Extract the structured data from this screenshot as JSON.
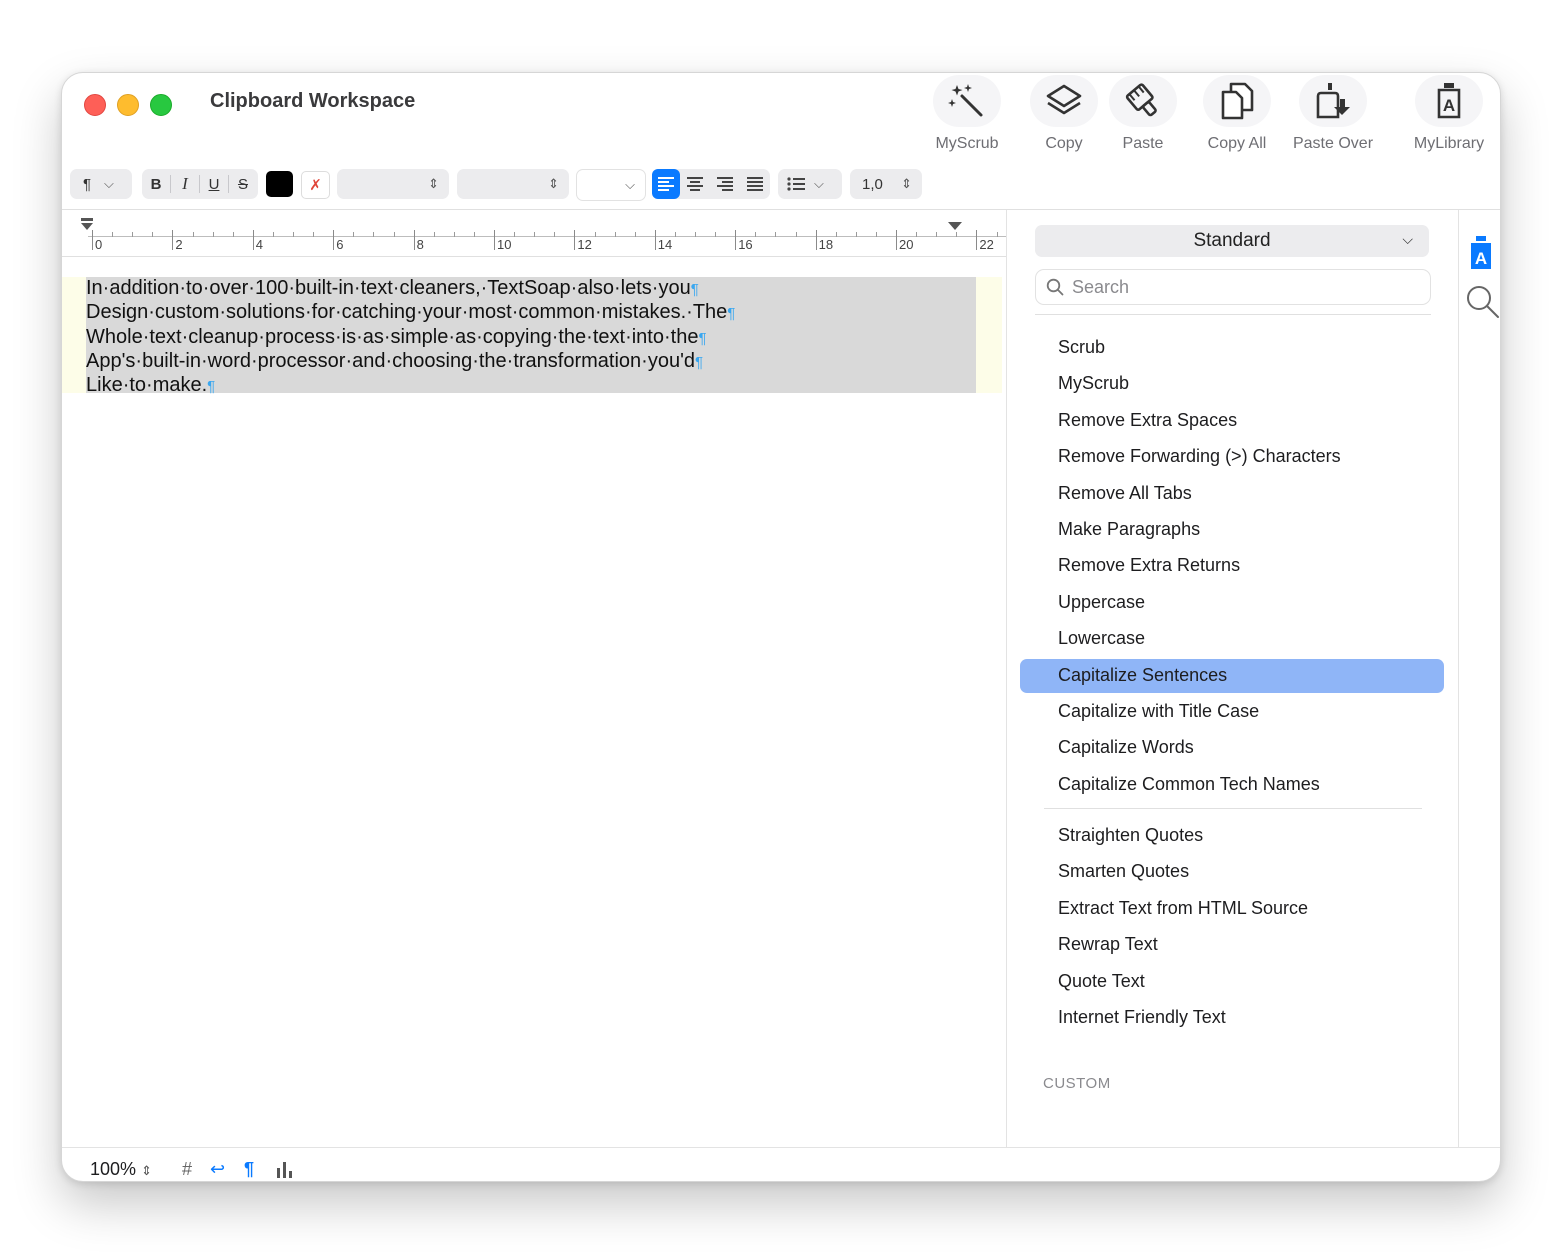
{
  "window": {
    "title": "Clipboard Workspace"
  },
  "toolbar": {
    "myscrub": "MyScrub",
    "copy": "Copy",
    "paste": "Paste",
    "copy_all": "Copy All",
    "paste_over": "Paste Over",
    "mylibrary": "MyLibrary"
  },
  "format_bar": {
    "paragraph_style_glyph": "¶",
    "bold": "B",
    "italic": "I",
    "underline": "U",
    "strike": "S",
    "text_color": "#000000",
    "line_spacing": "1,0",
    "alignment_selected": "left"
  },
  "ruler": {
    "labels": [
      "0",
      "2",
      "4",
      "6",
      "8",
      "10",
      "12",
      "14",
      "16",
      "18",
      "20",
      "22"
    ]
  },
  "editor": {
    "lines": [
      "In·addition·to·over·100·built-in·text·cleaners,·TextSoap·also·lets·you",
      "Design·custom·solutions·for·catching·your·most·common·mistakes.·The",
      "Whole·text·cleanup·process·is·as·simple·as·copying·the·text·into·the",
      "App's·built-in·word·processor·and·choosing·the·transformation·you'd",
      "Like·to·make."
    ],
    "pilcrow": "¶"
  },
  "sidebar": {
    "set": "Standard",
    "search_placeholder": "Search",
    "actions_group1": [
      "Scrub",
      "MyScrub",
      "Remove Extra Spaces",
      "Remove Forwarding (>) Characters",
      "Remove All Tabs",
      "Make Paragraphs",
      "Remove Extra Returns",
      "Uppercase",
      "Lowercase",
      "Capitalize Sentences",
      "Capitalize with Title Case",
      "Capitalize Words",
      "Capitalize Common Tech Names"
    ],
    "actions_group2": [
      "Straighten Quotes",
      "Smarten Quotes",
      "Extract Text from HTML Source",
      "Rewrap Text",
      "Quote Text",
      "Internet Friendly Text"
    ],
    "selected_action": "Capitalize Sentences",
    "custom_header": "CUSTOM"
  },
  "status_bar": {
    "zoom": "100%",
    "hash_glyph": "#",
    "return_glyph": "↩",
    "pilcrow_glyph": "¶"
  },
  "colors": {
    "accent": "#0a7aff",
    "selection": "#8fb5f7"
  }
}
